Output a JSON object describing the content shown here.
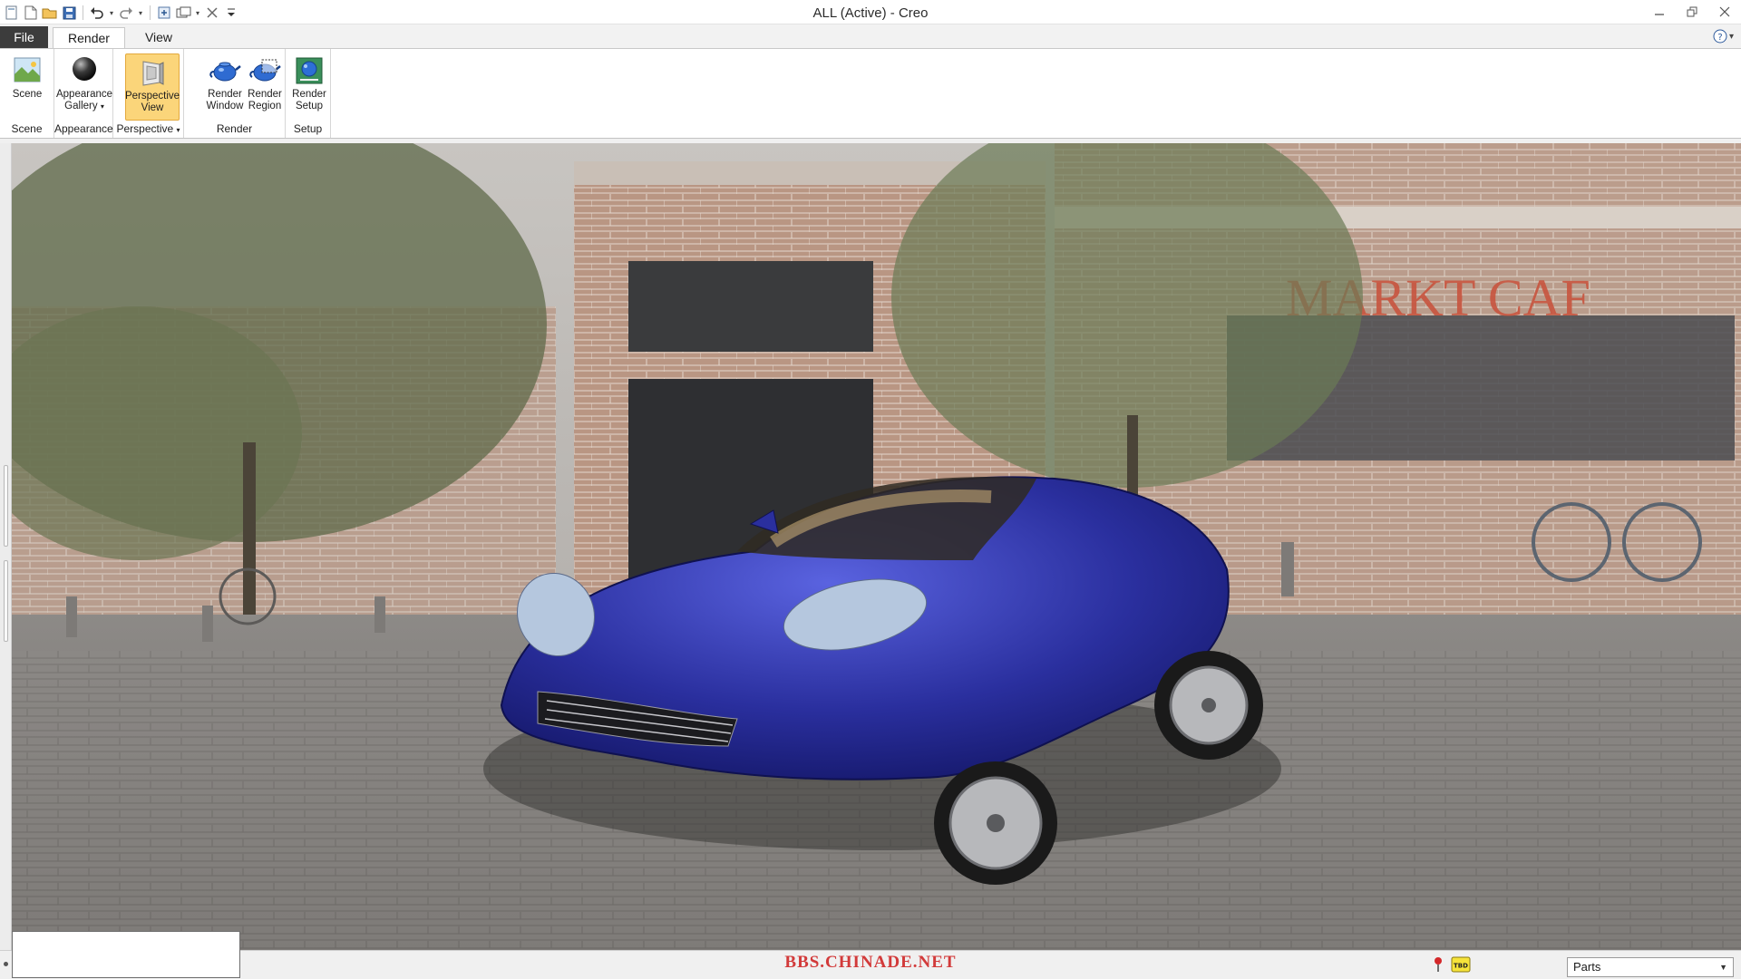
{
  "window": {
    "title": "ALL (Active) - Creo"
  },
  "quick_access": {
    "icons": [
      "new-icon",
      "new-file-icon",
      "open-icon",
      "save-icon",
      "undo-icon",
      "redo-icon",
      "regenerate-icon",
      "windows-icon",
      "close-window-icon",
      "customize-icon"
    ]
  },
  "tabs": [
    {
      "label": "File"
    },
    {
      "label": "Render"
    },
    {
      "label": "View"
    }
  ],
  "ribbon": {
    "groups": [
      {
        "label": "Scene",
        "buttons": [
          {
            "label": "Scene"
          }
        ]
      },
      {
        "label": "Appearance",
        "buttons": [
          {
            "label_line1": "Appearance",
            "label_line2": "Gallery"
          }
        ]
      },
      {
        "label": "Perspective",
        "buttons": [
          {
            "label_line1": "Perspective",
            "label_line2": "View"
          }
        ]
      },
      {
        "label": "Render",
        "buttons": [
          {
            "label_line1": "Render",
            "label_line2": "Window"
          },
          {
            "label_line1": "Render",
            "label_line2": "Region"
          }
        ]
      },
      {
        "label": "Setup",
        "buttons": [
          {
            "label_line1": "Render",
            "label_line2": "Setup"
          }
        ]
      }
    ]
  },
  "viewport": {
    "signage": "MARKT CAF",
    "accent": "#2a2f9e"
  },
  "statusbar": {
    "watermark": "BBS.CHINADE.NET",
    "filter_value": "Parts",
    "badge": "TBD"
  },
  "colors": {
    "file_tab": "#3c3c3c",
    "active_button": "#fbd57a",
    "watermark": "#d23a3a"
  }
}
